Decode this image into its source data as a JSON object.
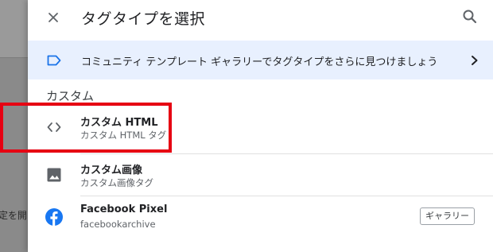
{
  "background": {
    "peek_text": "定を開"
  },
  "header": {
    "title": "タグタイプを選択"
  },
  "banner": {
    "text": "コミュニティ テンプレート ギャラリーでタグタイプをさらに見つけましょう",
    "icon": "tag-outline-icon"
  },
  "section": {
    "label": "カスタム"
  },
  "items": [
    {
      "name": "カスタム HTML",
      "sub": "カスタム HTML タグ",
      "icon": "code-brackets-icon"
    },
    {
      "name": "カスタム画像",
      "sub": "カスタム画像タグ",
      "icon": "image-icon"
    },
    {
      "name": "Facebook Pixel",
      "sub": "facebookarchive",
      "icon": "facebook-icon",
      "badge": "ギャラリー"
    }
  ],
  "colors": {
    "accent_blue": "#1a73e8",
    "banner_bg": "#e8f0fe",
    "highlight_red": "#e60012",
    "facebook_blue": "#1877f2"
  }
}
